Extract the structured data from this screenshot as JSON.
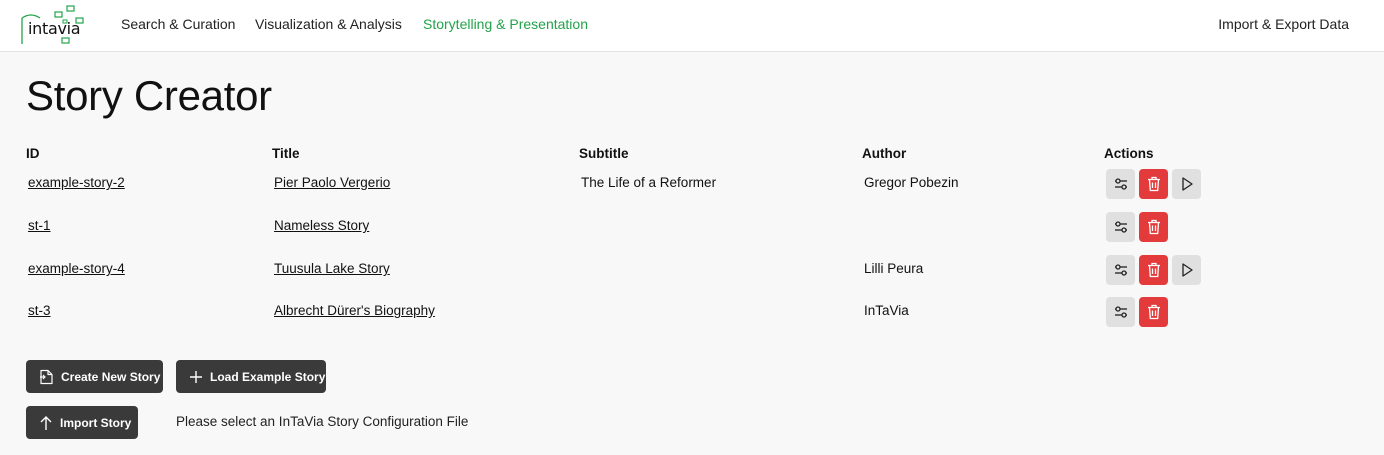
{
  "logo": {
    "text": "intavia"
  },
  "nav": {
    "search": "Search & Curation",
    "visualization": "Visualization & Analysis",
    "storytelling": "Storytelling & Presentation",
    "import_export": "Import & Export Data"
  },
  "page": {
    "title": "Story Creator"
  },
  "table": {
    "headers": {
      "id": "ID",
      "title": "Title",
      "subtitle": "Subtitle",
      "author": "Author",
      "actions": "Actions"
    },
    "rows": [
      {
        "id": "example-story-2",
        "title": "Pier Paolo Vergerio",
        "subtitle": "The Life of a Reformer",
        "author": "Gregor Pobezin",
        "playable": true
      },
      {
        "id": "st-1",
        "title": "Nameless Story",
        "subtitle": "",
        "author": "",
        "playable": false
      },
      {
        "id": "example-story-4",
        "title": "Tuusula Lake Story",
        "subtitle": "",
        "author": "Lilli Peura",
        "playable": true
      },
      {
        "id": "st-3",
        "title": "Albrecht Dürer's Biography",
        "subtitle": "",
        "author": "InTaVia",
        "playable": false
      }
    ]
  },
  "buttons": {
    "create": "Create New Story",
    "load_example": "Load Example Story",
    "import": "Import Story"
  },
  "import_hint": "Please select an InTaVia Story Configuration File",
  "colors": {
    "accent": "#22a34a",
    "danger": "#e33b3b",
    "button_dark": "#3a3a3a",
    "action_grey": "#e0e0e0"
  },
  "icons": {
    "edit": "sliders-icon",
    "delete": "trash-icon",
    "play": "play-icon",
    "create": "file-plus-icon",
    "load": "plus-icon",
    "import": "arrow-up-icon"
  }
}
